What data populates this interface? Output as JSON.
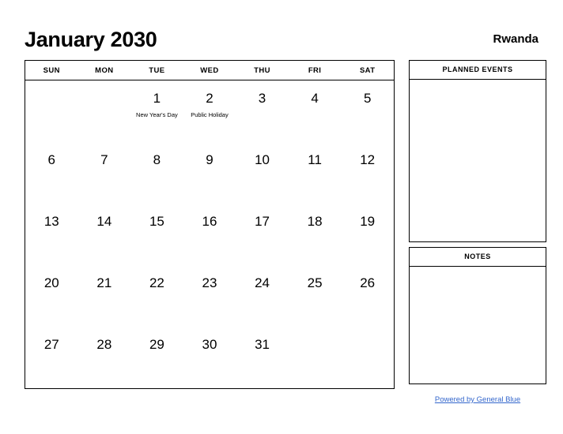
{
  "header": {
    "title": "January 2030",
    "region": "Rwanda"
  },
  "calendar": {
    "weekday_headers": [
      "SUN",
      "MON",
      "TUE",
      "WED",
      "THU",
      "FRI",
      "SAT"
    ],
    "weeks": [
      [
        {
          "day": "",
          "event": ""
        },
        {
          "day": "",
          "event": ""
        },
        {
          "day": "1",
          "event": "New Year's Day"
        },
        {
          "day": "2",
          "event": "Public Holiday"
        },
        {
          "day": "3",
          "event": ""
        },
        {
          "day": "4",
          "event": ""
        },
        {
          "day": "5",
          "event": ""
        }
      ],
      [
        {
          "day": "6",
          "event": ""
        },
        {
          "day": "7",
          "event": ""
        },
        {
          "day": "8",
          "event": ""
        },
        {
          "day": "9",
          "event": ""
        },
        {
          "day": "10",
          "event": ""
        },
        {
          "day": "11",
          "event": ""
        },
        {
          "day": "12",
          "event": ""
        }
      ],
      [
        {
          "day": "13",
          "event": ""
        },
        {
          "day": "14",
          "event": ""
        },
        {
          "day": "15",
          "event": ""
        },
        {
          "day": "16",
          "event": ""
        },
        {
          "day": "17",
          "event": ""
        },
        {
          "day": "18",
          "event": ""
        },
        {
          "day": "19",
          "event": ""
        }
      ],
      [
        {
          "day": "20",
          "event": ""
        },
        {
          "day": "21",
          "event": ""
        },
        {
          "day": "22",
          "event": ""
        },
        {
          "day": "23",
          "event": ""
        },
        {
          "day": "24",
          "event": ""
        },
        {
          "day": "25",
          "event": ""
        },
        {
          "day": "26",
          "event": ""
        }
      ],
      [
        {
          "day": "27",
          "event": ""
        },
        {
          "day": "28",
          "event": ""
        },
        {
          "day": "29",
          "event": ""
        },
        {
          "day": "30",
          "event": ""
        },
        {
          "day": "31",
          "event": ""
        },
        {
          "day": "",
          "event": ""
        },
        {
          "day": "",
          "event": ""
        }
      ]
    ]
  },
  "panels": {
    "planned_events": {
      "title": "PLANNED EVENTS",
      "content": ""
    },
    "notes": {
      "title": "NOTES",
      "content": ""
    }
  },
  "footer": {
    "link_text": "Powered by General Blue"
  },
  "colors": {
    "link": "#3366cc",
    "border": "#000000",
    "text": "#000000",
    "background": "#ffffff"
  }
}
